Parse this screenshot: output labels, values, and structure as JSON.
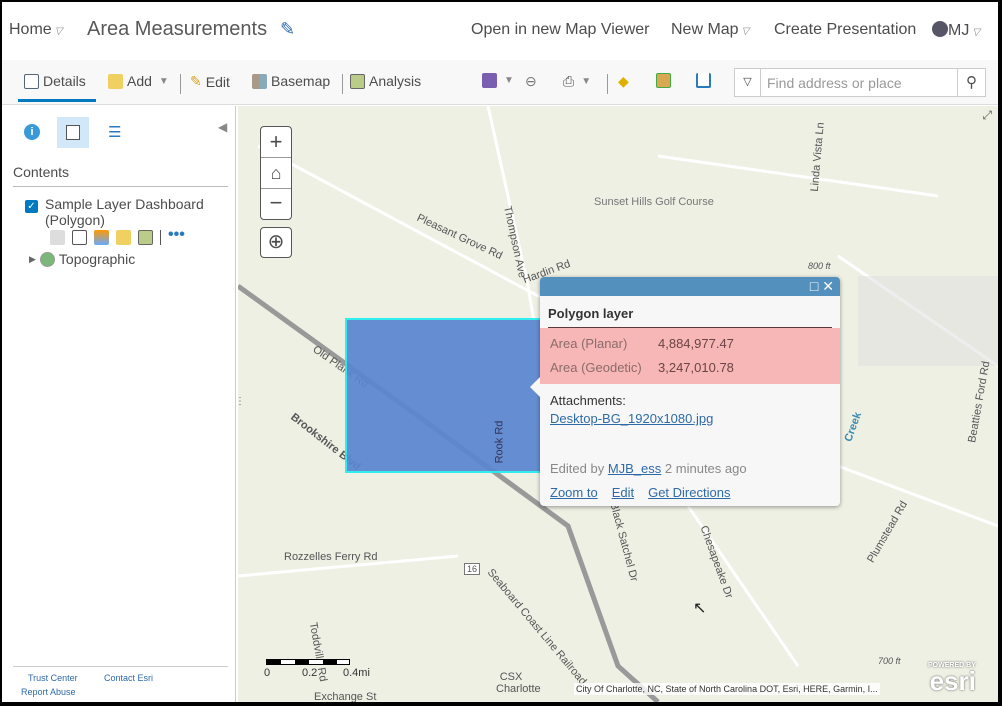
{
  "header": {
    "home": "Home",
    "title": "Area Measurements",
    "open_new": "Open in new Map Viewer",
    "new_map": "New Map",
    "create_presentation": "Create Presentation",
    "user": "MJ"
  },
  "toolbar": {
    "details": "Details",
    "add": "Add",
    "edit": "Edit",
    "basemap": "Basemap",
    "analysis": "Analysis",
    "search_placeholder": "Find address or place"
  },
  "contents": {
    "heading": "Contents",
    "layer": "Sample Layer Dashboard (Polygon)",
    "layer_checked": true,
    "basemap": "Topographic"
  },
  "footer": {
    "trust": "Trust Center",
    "contact": "Contact Esri",
    "report": "Report Abuse"
  },
  "map": {
    "labels": [
      "Sunset Hills Golf Course",
      "Pleasant Grove Rd",
      "Thompson Ave",
      "Old Plank Rd",
      "Brookshire Blvd",
      "Rozzelles Ferry Rd",
      "Toddville Rd",
      "Seaboard Coast Line Railroad",
      "CSX Charlotte",
      "Linda Vista Ln",
      "Beatties Ford Rd",
      "Plumstead Rd",
      "Chesapeake Dr",
      "Black Satchel Dr",
      "Rook Rd",
      "Creek",
      "800 ft",
      "700 ft",
      "16",
      "Exchange St",
      "Hardin Rd"
    ],
    "scale": [
      "0",
      "0.2",
      "0.4mi"
    ],
    "attribution": "City Of Charlotte, NC, State of North Carolina DOT, Esri, HERE, Garmin, I...",
    "powered": "POWERED BY",
    "esri": "esri"
  },
  "popup": {
    "title": "Polygon layer",
    "rows": [
      {
        "label": "Area (Planar)",
        "value": "4,884,977.47"
      },
      {
        "label": "Area (Geodetic)",
        "value": "3,247,010.78"
      }
    ],
    "attachments_label": "Attachments:",
    "attachment": "Desktop-BG_1920x1080.jpg",
    "edited_prefix": "Edited by",
    "editor": "MJB_ess",
    "edited_suffix": "2 minutes ago",
    "actions": [
      "Zoom to",
      "Edit",
      "Get Directions"
    ]
  },
  "colors": {
    "accent": "#0079c1",
    "popup_header": "#5390bd",
    "highlight": "#f8b7b7",
    "polygon": "#5b86d0"
  }
}
